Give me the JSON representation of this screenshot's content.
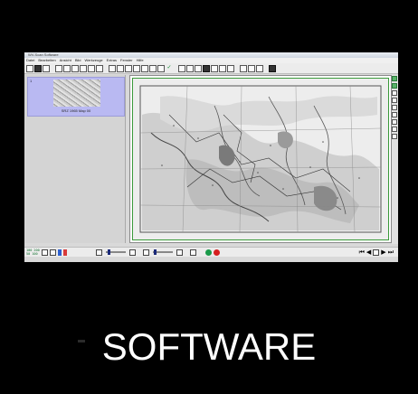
{
  "window": {
    "title": "WV-Scan Software",
    "menu": [
      "Datei",
      "Bearbeiten",
      "Ansicht",
      "Bild",
      "Werkzeuge",
      "Extras",
      "Fenster",
      "Hilfe"
    ]
  },
  "toolbar": {
    "icons": [
      "new-icon",
      "open-icon",
      "save-icon",
      "print-icon",
      "scan-icon",
      "zoom-in-icon",
      "zoom-out-icon",
      "crop-icon",
      "rotate-icon",
      "check-icon",
      "copy-icon",
      "paste-icon",
      "settings-icon"
    ],
    "check_symbol": "✓"
  },
  "sidebar": {
    "items": [
      {
        "tag": "1",
        "label": "SRZ 1965 Map 00"
      }
    ]
  },
  "statusbar": {
    "zoom_line1": "100 200",
    "zoom_line2": "50 100",
    "nav_first": "⏮",
    "nav_prev": "◀",
    "nav_next": "▶",
    "nav_last": "⏭"
  },
  "brand": {
    "text": "SOFTWARE"
  },
  "colors": {
    "accent": "#b9b9f2",
    "frame": "#3a9a3a",
    "status_green": "#1a9a4a",
    "status_red": "#d62020"
  }
}
